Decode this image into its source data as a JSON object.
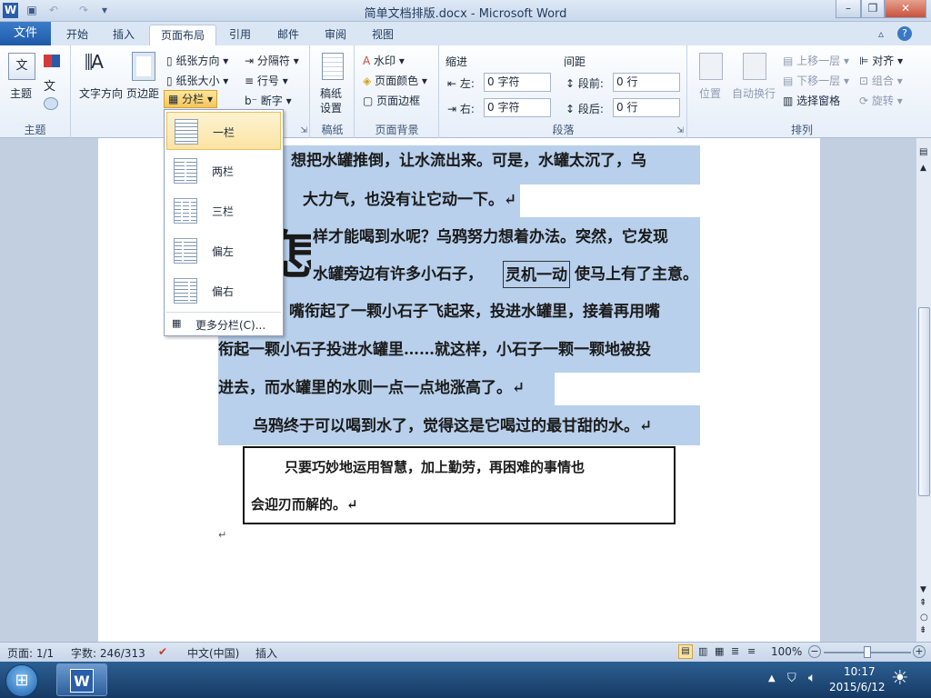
{
  "window": {
    "title": "简单文档排版.docx - Microsoft Word"
  },
  "tabs": {
    "file": "文件",
    "home": "开始",
    "insert": "插入",
    "layout": "页面布局",
    "references": "引用",
    "mailings": "邮件",
    "review": "审阅",
    "view": "视图"
  },
  "ribbon": {
    "themes": {
      "themes_btn": "主题",
      "label": "主题"
    },
    "page_setup": {
      "text_direction": "文字方向",
      "margins": "页边距",
      "orientation": "纸张方向",
      "size": "纸张大小",
      "columns": "分栏",
      "breaks": "分隔符",
      "line_numbers": "行号",
      "hyphenation": "断字"
    },
    "manuscript": {
      "btn_line1": "稿纸",
      "btn_line2": "设置",
      "label": "稿纸"
    },
    "background": {
      "watermark": "水印",
      "page_color": "页面颜色",
      "page_borders": "页面边框",
      "label": "页面背景"
    },
    "paragraph": {
      "indent_title": "缩进",
      "spacing_title": "间距",
      "left_label": "左:",
      "left_value": "0 字符",
      "right_label": "右:",
      "right_value": "0 字符",
      "before_label": "段前:",
      "before_value": "0 行",
      "after_label": "段后:",
      "after_value": "0 行",
      "label": "段落"
    },
    "arrange": {
      "position": "位置",
      "wrap": "自动换行",
      "bring_forward": "上移一层",
      "send_backward": "下移一层",
      "selection_pane": "选择窗格",
      "align": "对齐",
      "group": "组合",
      "rotate": "旋转",
      "label": "排列"
    }
  },
  "columns_menu": {
    "items": [
      "一栏",
      "两栏",
      "三栏",
      "偏左",
      "偏右"
    ],
    "more": "更多分栏(C)..."
  },
  "document": {
    "lines": [
      "璃，想把水罐推倒，让水流出来。可是，水罐太沉了，乌",
      "大力气，也没有让它动一下。↵",
      "样才能喝到水呢？乌鸦努力想着办法。突然，它发现",
      "水罐旁边有许多小石子，",
      "灵机一动",
      "使马上有了主意。",
      "嘴衔起了一颗小石子飞起来，投进水罐里，接着再用嘴",
      "衔起一颗小石子投进水罐里……就这样，小石子一颗一颗地被投",
      "进去，而水罐里的水则一点一点地涨高了。↵",
      "乌鸦终于可以喝到水了，觉得这是它喝过的最甘甜的水。↵"
    ],
    "dropcap": "怎",
    "box_lines": [
      "只要巧妙地运用智慧，加上勤劳，再困难的事情也",
      "会迎刃而解的。↵"
    ],
    "end_mark": "↵"
  },
  "status": {
    "page": "页面: 1/1",
    "words": "字数: 246/313",
    "language": "中文(中国)",
    "mode": "插入",
    "zoom": "100%"
  },
  "taskbar": {
    "time": "10:17",
    "date": "2015/6/12"
  }
}
